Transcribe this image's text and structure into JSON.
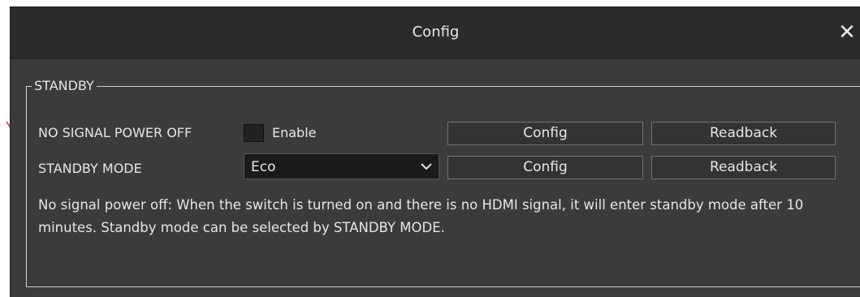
{
  "annotation": {
    "arrow_color": "#e21c1c"
  },
  "window": {
    "title": "Config",
    "close_icon": "close-icon"
  },
  "standby_group": {
    "title": "STANDBY",
    "no_signal_power_off": {
      "label": "NO SIGNAL POWER OFF",
      "enable_label": "Enable",
      "enabled": false,
      "config_label": "Config",
      "readback_label": "Readback"
    },
    "standby_mode": {
      "label": "STANDBY MODE",
      "selected": "Eco",
      "config_label": "Config",
      "readback_label": "Readback"
    },
    "description": "No signal power off: When the switch is turned on  and there is no HDMI signal, it will enter standby mode after 10 minutes. Standby mode can be selected by STANDBY MODE."
  }
}
